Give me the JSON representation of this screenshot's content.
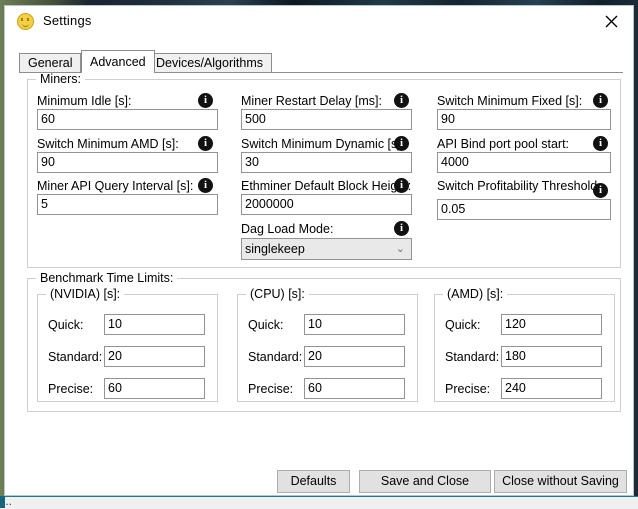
{
  "window": {
    "title": "Settings",
    "icon": "coin-smiley-icon",
    "close_label": "✕"
  },
  "tabs": [
    {
      "label": "General",
      "selected": false
    },
    {
      "label": "Advanced",
      "selected": true
    },
    {
      "label": "Devices/Algorithms",
      "selected": false
    }
  ],
  "miners": {
    "legend": "Miners:",
    "info_glyph": "i",
    "fields": [
      {
        "label": "Minimum Idle [s]:",
        "value": "60"
      },
      {
        "label": "Miner Restart Delay [ms]:",
        "value": "500"
      },
      {
        "label": "Switch Minimum Fixed [s]:",
        "value": "90"
      },
      {
        "label": "Switch Minimum AMD [s]:",
        "value": "90"
      },
      {
        "label": "Switch Minimum Dynamic [s]:",
        "value": "30"
      },
      {
        "label": "API Bind port pool start:",
        "value": "4000"
      },
      {
        "label": "Miner API Query Interval [s]:",
        "value": "5"
      },
      {
        "label": "Ethminer Default Block Height:",
        "value": "2000000"
      },
      {
        "label": "Switch Profitability Threshold",
        "value": "0.05"
      }
    ],
    "dag": {
      "label": "Dag Load Mode:",
      "value": "singlekeep",
      "chevron": "⌄"
    }
  },
  "benchmark": {
    "legend": "Benchmark Time Limits:",
    "row_labels": [
      "Quick:",
      "Standard:",
      "Precise:"
    ],
    "groups": [
      {
        "legend": "(NVIDIA) [s]:",
        "values": [
          "10",
          "20",
          "60"
        ]
      },
      {
        "legend": "(CPU) [s]:",
        "values": [
          "10",
          "20",
          "60"
        ]
      },
      {
        "legend": "(AMD) [s]:",
        "values": [
          "120",
          "180",
          "240"
        ]
      }
    ]
  },
  "footer": {
    "defaults": "Defaults",
    "save_and_close": "Save and Close",
    "close_without_saving": "Close without Saving"
  },
  "background": {
    "cut_text": "..."
  }
}
